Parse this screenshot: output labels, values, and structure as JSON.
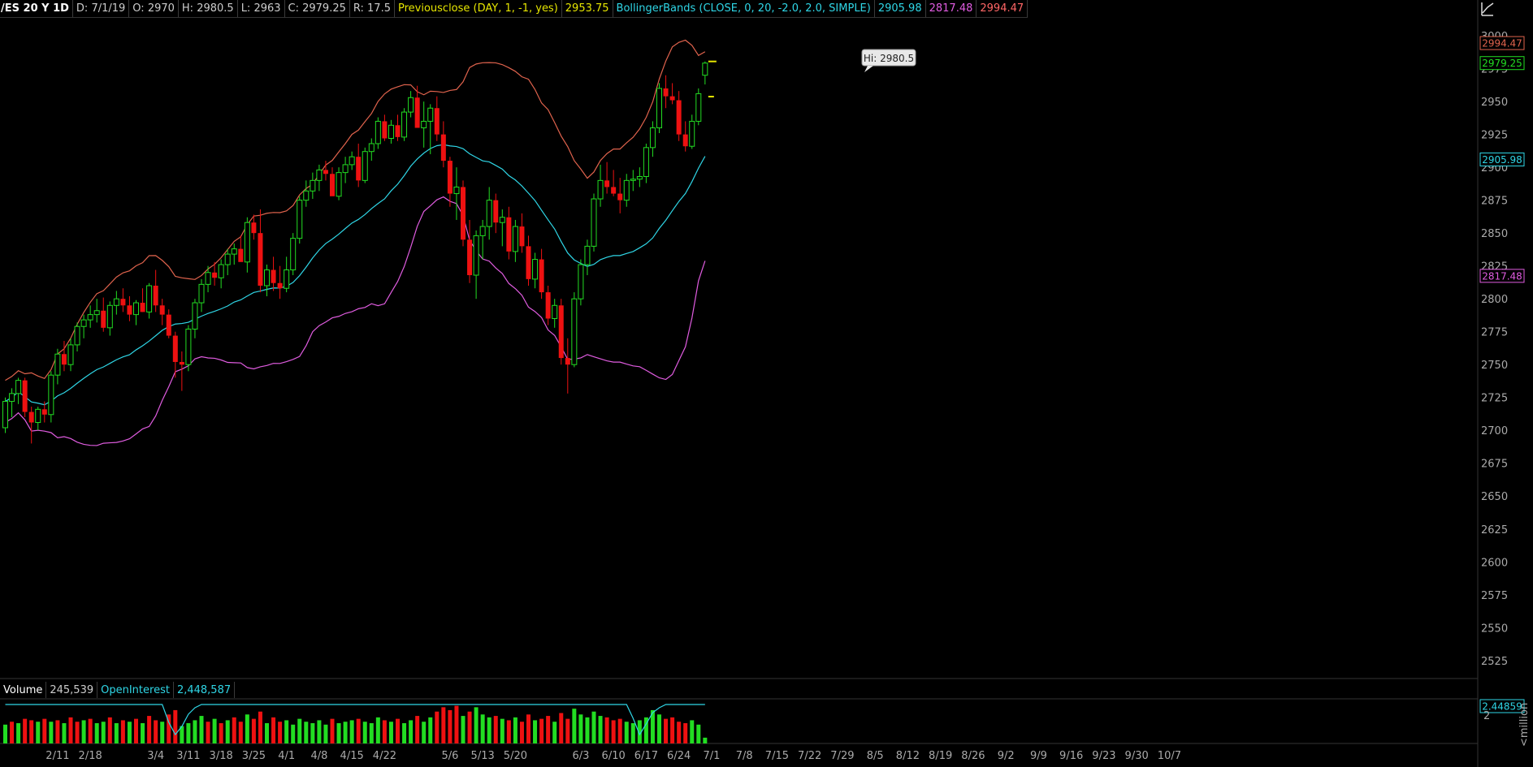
{
  "header": {
    "symbol": "/ES 20 Y 1D",
    "date": "D: 7/1/19",
    "open": "O: 2970",
    "high": "H: 2980.5",
    "low": "L: 2963",
    "close": "C: 2979.25",
    "range": "R: 17.5",
    "study1_label": "Previousclose (DAY, 1, -1, yes)",
    "study1_value": "2953.75",
    "study2_label": "BollingerBands (CLOSE, 0, 20, -2.0, 2.0, SIMPLE)",
    "study2_mid": "2905.98",
    "study2_lower": "2817.48",
    "study2_upper": "2994.47"
  },
  "volume_header": {
    "label": "Volume",
    "value": "245,539",
    "oi_label": "OpenInterest",
    "oi_value": "2,448,587"
  },
  "colors": {
    "up": "#22dd22",
    "down": "#ee1111",
    "upper_band": "#e0634d",
    "middle_band": "#2fd6e6",
    "lower_band": "#e05ce0",
    "prev_close": "#e6e600",
    "header_yellow": "#e6e600",
    "header_cyan": "#2fd6e6",
    "header_magenta": "#e05ce0",
    "header_red": "#ff6666"
  },
  "chart_data": {
    "type": "candlestick",
    "y_ticks": [
      2525,
      2550,
      2575,
      2600,
      2625,
      2650,
      2675,
      2700,
      2725,
      2750,
      2775,
      2800,
      2825,
      2850,
      2875,
      2900,
      2925,
      2950,
      2975,
      3000
    ],
    "y_range": [
      2515,
      3005
    ],
    "x_labels": [
      "2/11",
      "2/18",
      "3/4",
      "3/11",
      "3/18",
      "3/25",
      "4/1",
      "4/8",
      "4/15",
      "4/22",
      "5/6",
      "5/13",
      "5/20",
      "6/3",
      "6/10",
      "6/17",
      "6/24",
      "7/1",
      "7/8",
      "7/15",
      "7/22",
      "7/29",
      "8/5",
      "8/12",
      "8/19",
      "8/26",
      "9/2",
      "9/9",
      "9/16",
      "9/23",
      "9/30",
      "10/7"
    ],
    "x_label_index": [
      8,
      13,
      23,
      28,
      33,
      38,
      43,
      48,
      53,
      58,
      68,
      73,
      78,
      88,
      93,
      98,
      103,
      108,
      113,
      118,
      123,
      128,
      133,
      138,
      143,
      148,
      153,
      158,
      163,
      168,
      173,
      178
    ],
    "hi_label": "Hi: 2980.5",
    "price_tags": [
      {
        "value": "2994.47",
        "price": 2994.47,
        "color": "#e0634d"
      },
      {
        "value": "2979.25",
        "price": 2979.25,
        "color": "#22dd22"
      },
      {
        "value": "2905.98",
        "price": 2905.98,
        "color": "#2fd6e6"
      },
      {
        "value": "2817.48",
        "price": 2817.48,
        "color": "#e05ce0"
      }
    ],
    "prev_close": 2953.75,
    "volume_axis_tag": "2.44859",
    "volume_tick": "2",
    "volume_axis_unit": "<million",
    "candles": [
      [
        2702,
        2725,
        2698,
        2722
      ],
      [
        2722,
        2732,
        2710,
        2728
      ],
      [
        2728,
        2740,
        2720,
        2738
      ],
      [
        2738,
        2740,
        2710,
        2714
      ],
      [
        2714,
        2718,
        2690,
        2706
      ],
      [
        2706,
        2718,
        2700,
        2716
      ],
      [
        2716,
        2722,
        2706,
        2712
      ],
      [
        2712,
        2745,
        2706,
        2742
      ],
      [
        2742,
        2762,
        2735,
        2758
      ],
      [
        2758,
        2768,
        2745,
        2750
      ],
      [
        2750,
        2770,
        2745,
        2765
      ],
      [
        2765,
        2782,
        2760,
        2779
      ],
      [
        2779,
        2788,
        2770,
        2784
      ],
      [
        2784,
        2795,
        2778,
        2788
      ],
      [
        2788,
        2800,
        2782,
        2791
      ],
      [
        2791,
        2801,
        2775,
        2778
      ],
      [
        2778,
        2798,
        2772,
        2795
      ],
      [
        2795,
        2806,
        2788,
        2800
      ],
      [
        2800,
        2808,
        2790,
        2795
      ],
      [
        2795,
        2802,
        2783,
        2788
      ],
      [
        2788,
        2799,
        2780,
        2797
      ],
      [
        2797,
        2808,
        2790,
        2790
      ],
      [
        2790,
        2812,
        2785,
        2810
      ],
      [
        2810,
        2822,
        2790,
        2795
      ],
      [
        2795,
        2800,
        2780,
        2788
      ],
      [
        2788,
        2792,
        2770,
        2772
      ],
      [
        2772,
        2775,
        2740,
        2752
      ],
      [
        2752,
        2760,
        2730,
        2750
      ],
      [
        2750,
        2780,
        2745,
        2777
      ],
      [
        2777,
        2800,
        2770,
        2797
      ],
      [
        2797,
        2815,
        2790,
        2811
      ],
      [
        2811,
        2825,
        2805,
        2820
      ],
      [
        2820,
        2828,
        2810,
        2816
      ],
      [
        2816,
        2830,
        2808,
        2826
      ],
      [
        2826,
        2838,
        2818,
        2834
      ],
      [
        2834,
        2842,
        2826,
        2838
      ],
      [
        2838,
        2848,
        2830,
        2828
      ],
      [
        2828,
        2862,
        2820,
        2858
      ],
      [
        2858,
        2864,
        2845,
        2850
      ],
      [
        2850,
        2868,
        2805,
        2810
      ],
      [
        2810,
        2826,
        2802,
        2822
      ],
      [
        2822,
        2832,
        2806,
        2812
      ],
      [
        2812,
        2825,
        2800,
        2808
      ],
      [
        2808,
        2832,
        2805,
        2822
      ],
      [
        2822,
        2850,
        2818,
        2846
      ],
      [
        2846,
        2878,
        2842,
        2875
      ],
      [
        2875,
        2890,
        2870,
        2882
      ],
      [
        2882,
        2896,
        2876,
        2890
      ],
      [
        2890,
        2902,
        2882,
        2898
      ],
      [
        2898,
        2905,
        2890,
        2895
      ],
      [
        2895,
        2900,
        2880,
        2878
      ],
      [
        2878,
        2900,
        2875,
        2896
      ],
      [
        2896,
        2908,
        2888,
        2902
      ],
      [
        2902,
        2912,
        2898,
        2908
      ],
      [
        2908,
        2918,
        2885,
        2890
      ],
      [
        2890,
        2915,
        2888,
        2912
      ],
      [
        2912,
        2922,
        2905,
        2918
      ],
      [
        2918,
        2938,
        2914,
        2935
      ],
      [
        2935,
        2940,
        2920,
        2922
      ],
      [
        2922,
        2936,
        2918,
        2932
      ],
      [
        2932,
        2940,
        2920,
        2923
      ],
      [
        2923,
        2945,
        2920,
        2942
      ],
      [
        2942,
        2958,
        2938,
        2953
      ],
      [
        2953,
        2962,
        2932,
        2930
      ],
      [
        2930,
        2950,
        2915,
        2935
      ],
      [
        2935,
        2948,
        2910,
        2945
      ],
      [
        2945,
        2954,
        2920,
        2925
      ],
      [
        2925,
        2935,
        2900,
        2905
      ],
      [
        2905,
        2908,
        2870,
        2880
      ],
      [
        2880,
        2900,
        2860,
        2885
      ],
      [
        2885,
        2890,
        2840,
        2845
      ],
      [
        2845,
        2860,
        2812,
        2818
      ],
      [
        2818,
        2852,
        2800,
        2848
      ],
      [
        2848,
        2860,
        2830,
        2855
      ],
      [
        2855,
        2885,
        2845,
        2875
      ],
      [
        2875,
        2880,
        2850,
        2858
      ],
      [
        2858,
        2868,
        2840,
        2862
      ],
      [
        2862,
        2870,
        2830,
        2836
      ],
      [
        2836,
        2860,
        2828,
        2855
      ],
      [
        2855,
        2865,
        2835,
        2840
      ],
      [
        2840,
        2848,
        2810,
        2815
      ],
      [
        2815,
        2835,
        2808,
        2830
      ],
      [
        2830,
        2838,
        2800,
        2805
      ],
      [
        2805,
        2810,
        2780,
        2785
      ],
      [
        2785,
        2800,
        2778,
        2795
      ],
      [
        2795,
        2800,
        2750,
        2755
      ],
      [
        2755,
        2770,
        2728,
        2750
      ],
      [
        2750,
        2805,
        2748,
        2800
      ],
      [
        2800,
        2830,
        2795,
        2826
      ],
      [
        2826,
        2845,
        2818,
        2840
      ],
      [
        2840,
        2880,
        2836,
        2876
      ],
      [
        2876,
        2902,
        2870,
        2890
      ],
      [
        2890,
        2904,
        2880,
        2885
      ],
      [
        2885,
        2898,
        2878,
        2880
      ],
      [
        2880,
        2892,
        2865,
        2875
      ],
      [
        2875,
        2895,
        2870,
        2890
      ],
      [
        2890,
        2898,
        2882,
        2891
      ],
      [
        2891,
        2900,
        2885,
        2893
      ],
      [
        2893,
        2918,
        2888,
        2915
      ],
      [
        2915,
        2935,
        2908,
        2930
      ],
      [
        2930,
        2964,
        2926,
        2960
      ],
      [
        2960,
        2970,
        2945,
        2954
      ],
      [
        2954,
        2964,
        2948,
        2951
      ],
      [
        2951,
        2958,
        2920,
        2925
      ],
      [
        2925,
        2935,
        2912,
        2916
      ],
      [
        2916,
        2940,
        2914,
        2935
      ],
      [
        2935,
        2960,
        2932,
        2956
      ],
      [
        2970,
        2980.5,
        2963,
        2979.25
      ]
    ],
    "volume": [
      [
        1.3,
        0
      ],
      [
        1.5,
        1
      ],
      [
        1.4,
        0
      ],
      [
        1.7,
        1
      ],
      [
        1.6,
        1
      ],
      [
        1.5,
        0
      ],
      [
        1.7,
        1
      ],
      [
        1.5,
        0
      ],
      [
        1.6,
        1
      ],
      [
        1.4,
        0
      ],
      [
        1.8,
        1
      ],
      [
        1.5,
        1
      ],
      [
        1.6,
        0
      ],
      [
        1.7,
        1
      ],
      [
        1.4,
        0
      ],
      [
        1.5,
        0
      ],
      [
        1.8,
        1
      ],
      [
        1.4,
        0
      ],
      [
        1.6,
        1
      ],
      [
        1.5,
        0
      ],
      [
        1.7,
        1
      ],
      [
        1.4,
        0
      ],
      [
        1.9,
        1
      ],
      [
        1.6,
        1
      ],
      [
        1.5,
        0
      ],
      [
        2.0,
        1
      ],
      [
        2.3,
        1
      ],
      [
        1.2,
        0
      ],
      [
        1.4,
        0
      ],
      [
        1.6,
        0
      ],
      [
        1.9,
        0
      ],
      [
        1.5,
        1
      ],
      [
        1.7,
        0
      ],
      [
        1.4,
        1
      ],
      [
        1.6,
        0
      ],
      [
        1.8,
        1
      ],
      [
        1.5,
        1
      ],
      [
        2.0,
        0
      ],
      [
        1.7,
        1
      ],
      [
        2.2,
        1
      ],
      [
        1.4,
        0
      ],
      [
        1.8,
        1
      ],
      [
        1.5,
        1
      ],
      [
        1.6,
        0
      ],
      [
        1.3,
        0
      ],
      [
        1.7,
        0
      ],
      [
        1.5,
        0
      ],
      [
        1.4,
        0
      ],
      [
        1.6,
        0
      ],
      [
        1.3,
        0
      ],
      [
        1.7,
        1
      ],
      [
        1.4,
        0
      ],
      [
        1.5,
        0
      ],
      [
        1.6,
        0
      ],
      [
        1.7,
        1
      ],
      [
        1.5,
        0
      ],
      [
        1.4,
        0
      ],
      [
        1.8,
        0
      ],
      [
        1.6,
        1
      ],
      [
        1.5,
        0
      ],
      [
        1.7,
        1
      ],
      [
        1.4,
        0
      ],
      [
        1.6,
        0
      ],
      [
        1.9,
        1
      ],
      [
        1.5,
        0
      ],
      [
        1.8,
        0
      ],
      [
        2.2,
        1
      ],
      [
        2.5,
        1
      ],
      [
        2.3,
        1
      ],
      [
        2.6,
        1
      ],
      [
        1.9,
        0
      ],
      [
        2.2,
        1
      ],
      [
        2.5,
        0
      ],
      [
        2.0,
        0
      ],
      [
        1.8,
        0
      ],
      [
        1.9,
        1
      ],
      [
        1.7,
        0
      ],
      [
        1.6,
        1
      ],
      [
        1.8,
        0
      ],
      [
        1.5,
        1
      ],
      [
        2.0,
        1
      ],
      [
        1.6,
        0
      ],
      [
        1.7,
        1
      ],
      [
        1.9,
        1
      ],
      [
        1.5,
        0
      ],
      [
        2.1,
        1
      ],
      [
        1.7,
        1
      ],
      [
        2.4,
        0
      ],
      [
        2.0,
        0
      ],
      [
        1.8,
        0
      ],
      [
        2.2,
        0
      ],
      [
        1.9,
        0
      ],
      [
        1.8,
        1
      ],
      [
        1.6,
        1
      ],
      [
        1.7,
        1
      ],
      [
        1.5,
        0
      ],
      [
        1.4,
        0
      ],
      [
        1.6,
        0
      ],
      [
        1.8,
        0
      ],
      [
        2.3,
        0
      ],
      [
        2.0,
        0
      ],
      [
        1.7,
        1
      ],
      [
        1.8,
        1
      ],
      [
        1.5,
        1
      ],
      [
        1.4,
        1
      ],
      [
        1.6,
        0
      ],
      [
        1.3,
        0
      ],
      [
        0.4,
        0
      ]
    ]
  }
}
